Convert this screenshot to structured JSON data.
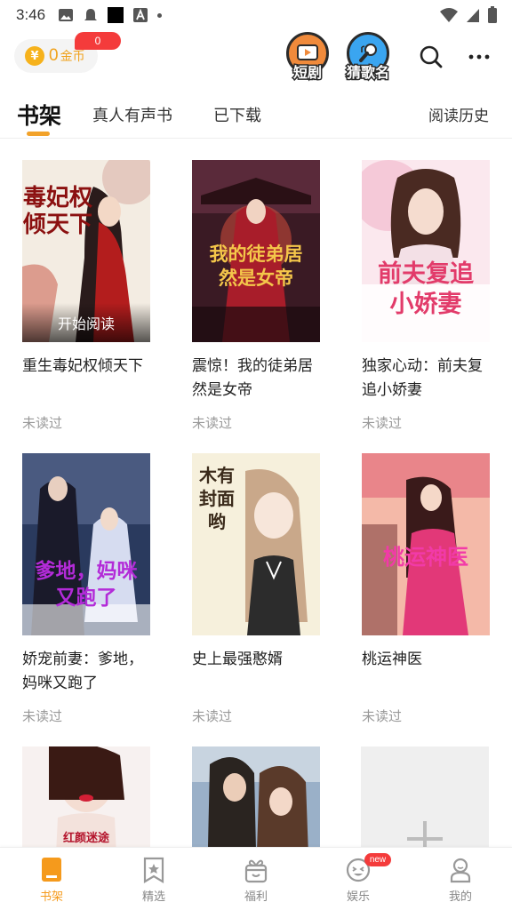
{
  "status_bar": {
    "time": "3:46"
  },
  "header": {
    "coins": {
      "amount": "0",
      "label": "金币",
      "badge": "0"
    },
    "promos": [
      {
        "label": "短剧",
        "icon": "video-player-icon"
      },
      {
        "label": "猜歌名",
        "icon": "microphone-icon"
      }
    ]
  },
  "tabs": [
    {
      "label": "书架",
      "active": true
    },
    {
      "label": "真人有声书",
      "active": false
    },
    {
      "label": "已下载",
      "active": false
    }
  ],
  "history_link": "阅读历史",
  "books": [
    {
      "title": "重生毒妃权倾天下",
      "status": "未读过",
      "cover_text": "毒妃权倾天下",
      "overlay": "开始阅读"
    },
    {
      "title": "震惊！我的徒弟居然是女帝",
      "status": "未读过",
      "cover_text": "我的徒弟居然是女帝"
    },
    {
      "title": "独家心动：前夫复追小娇妻",
      "status": "未读过",
      "cover_text": "前夫复追小娇妻"
    },
    {
      "title": "娇宠前妻：爹地，妈咪又跑了",
      "status": "未读过",
      "cover_text": "爹地，妈咪又跑了"
    },
    {
      "title": "史上最强憨婿",
      "status": "未读过",
      "cover_text": "木有封面哟"
    },
    {
      "title": "桃运神医",
      "status": "未读过",
      "cover_text": "桃运神医"
    }
  ],
  "bottom_covers": [
    {
      "cover_text": "红颜迷途"
    },
    {
      "cover_text": ""
    }
  ],
  "bottom_nav": [
    {
      "label": "书架",
      "icon": "bookshelf-icon",
      "active": true
    },
    {
      "label": "精选",
      "icon": "bookmark-star-icon",
      "active": false
    },
    {
      "label": "福利",
      "icon": "gift-icon",
      "active": false
    },
    {
      "label": "娱乐",
      "icon": "smiley-icon",
      "active": false,
      "badge": "new"
    },
    {
      "label": "我的",
      "icon": "profile-icon",
      "active": false
    }
  ],
  "colors": {
    "accent": "#f59a1c",
    "badge_red": "#f43b3b"
  }
}
